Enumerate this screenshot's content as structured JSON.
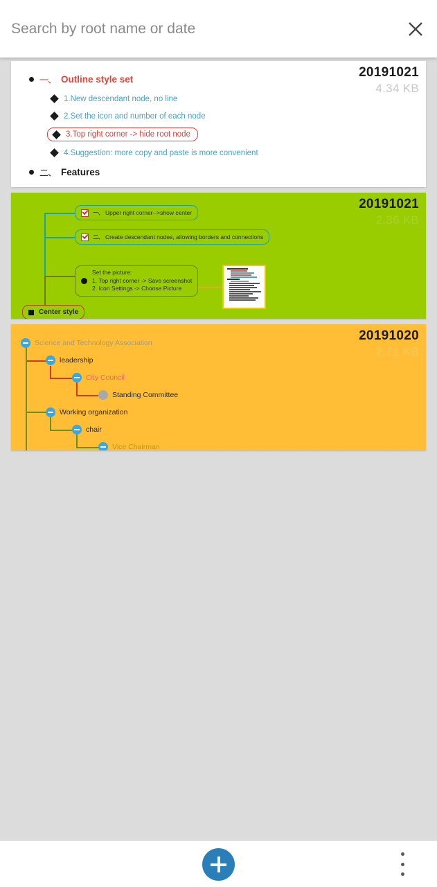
{
  "search": {
    "placeholder": "Search by root name or date",
    "value": "",
    "close_icon": "close-icon"
  },
  "cards": [
    {
      "date": "20191021",
      "size": "4.34 KB",
      "style": "outline",
      "background": "#ffffff",
      "outline_rows": [
        {
          "level": 1,
          "marker": "dot",
          "num": "一、",
          "text": "Outline style set",
          "color": "red",
          "boxed": false
        },
        {
          "level": 2,
          "marker": "diamond",
          "num": "",
          "text": "1.New descendant node, no line",
          "color": "blue",
          "boxed": false
        },
        {
          "level": 2,
          "marker": "diamond",
          "num": "",
          "text": "2.Set the icon and number of each node",
          "color": "blue",
          "boxed": false
        },
        {
          "level": 2,
          "marker": "diamond",
          "num": "",
          "text": "3.Top right corner -> hide root node",
          "color": "red",
          "boxed": true
        },
        {
          "level": 2,
          "marker": "diamond",
          "num": "",
          "text": "4.Suggestion: more copy and paste is more convenient",
          "color": "blue",
          "boxed": false
        },
        {
          "level": 1,
          "marker": "dot",
          "num": "二、",
          "text": "Features",
          "color": "dark",
          "boxed": false
        }
      ]
    },
    {
      "date": "20191021",
      "size": "2.36 KB",
      "style": "mindmap",
      "background": "#9acd00",
      "nodes": [
        {
          "id": "n1",
          "num": "一、",
          "text": "Upper right corner-->show center",
          "icon": "checkbox-checked-icon"
        },
        {
          "id": "n2",
          "num": "二、",
          "text": "Create descendant nodes, allowing borders and connections",
          "icon": "checkbox-checked-icon"
        },
        {
          "id": "n3",
          "line1": "Set the picture:",
          "line2": "1. Top right corner -> Save screenshot",
          "line3": "2. Icon Settings -> Choose Picture",
          "icon": "filled-circle-icon"
        },
        {
          "id": "n4",
          "text": "Center style",
          "icon": "filled-square-icon"
        }
      ],
      "thumbnail": "mindmap-screenshot-thumbnail"
    },
    {
      "date": "20191020",
      "size": "2.71 KB",
      "style": "orgtree",
      "background": "#ffbe35",
      "nodes": [
        {
          "id": "o1",
          "text": "Science and Technology Association",
          "color": "grey",
          "icon": "collapse-minus-icon"
        },
        {
          "id": "o2",
          "text": "leadership",
          "color": "dark",
          "icon": "collapse-minus-icon"
        },
        {
          "id": "o3",
          "text": "City Council",
          "color": "pink",
          "icon": "collapse-minus-icon"
        },
        {
          "id": "o4",
          "text": "Standing Committee",
          "color": "dark",
          "icon": "grey-dot-icon"
        },
        {
          "id": "o5",
          "text": "Working organization",
          "color": "dark",
          "icon": "collapse-minus-icon"
        },
        {
          "id": "o6",
          "text": "chair",
          "color": "dark",
          "icon": "collapse-minus-icon"
        },
        {
          "id": "o7",
          "text": "Vice Chairman",
          "color": "olive",
          "icon": "collapse-minus-icon"
        }
      ]
    }
  ],
  "bottom_bar": {
    "add_icon": "plus-icon",
    "overflow_icon": "more-vertical-icon",
    "accent_color": "#2a7fb8"
  }
}
